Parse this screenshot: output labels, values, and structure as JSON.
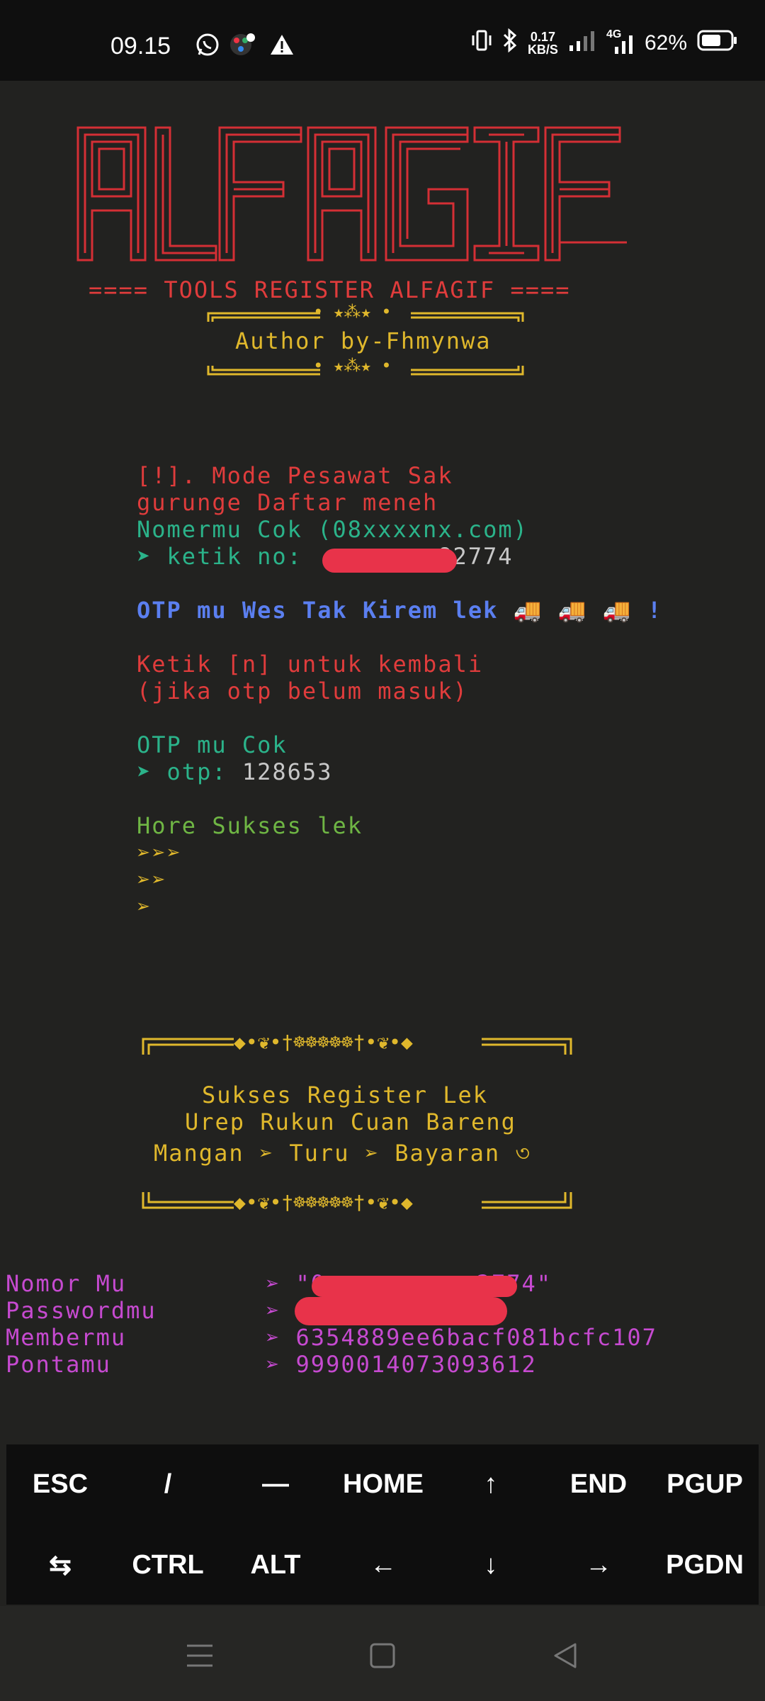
{
  "status_bar": {
    "time": "09.15",
    "net_speed_value": "0.17",
    "net_speed_unit": "KB/S",
    "network_type": "4G",
    "battery": "62%"
  },
  "banner": {
    "logo_text": "ALFAGIF",
    "subtitle": "==== TOOLS REGISTER ALFAGIF ====",
    "author": "Author by-Fhmynwa",
    "frame_ornament": "• ★⁂★ •",
    "colors": {
      "red": "#e03c3c",
      "gold": "#e0b82c"
    }
  },
  "terminal": {
    "warn_line1": "[!]. Mode Pesawat Sak",
    "warn_line2": "gurunge Daftar meneh",
    "number_prompt": "Nomermu Cok (08xxxxnx.com)",
    "ketik_label": "➤ ketik no: ",
    "ketik_value_visible": "82774",
    "otp_sent": "OTP mu Wes Tak Kirem lek 🚚 🚚 🚚 !",
    "back_hint1": "Ketik [n] untuk kembali",
    "back_hint2": "(jika otp belum masuk)",
    "otp_prompt": "OTP mu Cok",
    "otp_label": "➤ otp: ",
    "otp_value": "128653",
    "success": "Hore Sukses lek",
    "arrows1": "➢➢➢",
    "arrows2": "➢➢",
    "arrows3": "➢"
  },
  "success_box": {
    "ornament": "◆•❦•†☸☸☸☸☸†•❦•◆",
    "line1": "Sukses Register Lek",
    "line2": "Urep Rukun Cuan Bareng",
    "line3": "Mangan ➢ Turu ➢ Bayaran ৩"
  },
  "result": {
    "nomor_label": "Nomor Mu",
    "nomor_value": "➢ \"0          2774\"",
    "password_label": "Passwordmu",
    "password_value": "➢",
    "member_label": "Membermu",
    "member_value": "➢ 6354889ee6bacf081bcfc107",
    "ponta_label": "Pontamu",
    "ponta_value": "➢ 9990014073093612"
  },
  "extra_keys": {
    "row1": [
      "ESC",
      "/",
      "—",
      "HOME",
      "↑",
      "END",
      "PGUP"
    ],
    "row2": [
      "⇆",
      "CTRL",
      "ALT",
      "←",
      "↓",
      "→",
      "PGDN"
    ]
  }
}
